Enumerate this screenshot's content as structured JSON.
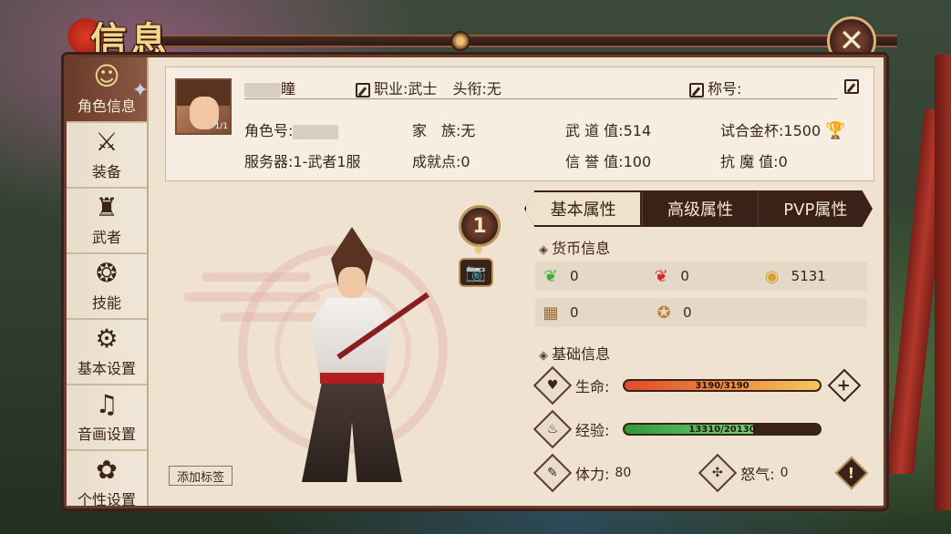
{
  "title": "信息",
  "sidebar": {
    "items": [
      {
        "label": "角色信息",
        "icon": "character-icon"
      },
      {
        "label": "装备",
        "icon": "equipment-icon"
      },
      {
        "label": "武者",
        "icon": "warrior-icon"
      },
      {
        "label": "技能",
        "icon": "skill-icon"
      },
      {
        "label": "基本设置",
        "icon": "settings-gear-icon"
      },
      {
        "label": "音画设置",
        "icon": "audio-visual-icon"
      },
      {
        "label": "个性设置",
        "icon": "personal-flower-icon"
      }
    ]
  },
  "profile": {
    "name_suffix": "瞳",
    "occupation_label": "职业:",
    "occupation": "武士",
    "rank_title_label": "头衔:",
    "rank_title": "无",
    "honor_label": "称号:",
    "honor": "",
    "role_id_label": "角色号:",
    "family_label": "家　族:",
    "family": "无",
    "wudao_label": "武 道 值:",
    "wudao": "514",
    "trial_cup_label": "试合金杯:",
    "trial_cup": "1500",
    "server_label": "服务器:",
    "server": "1-武者1服",
    "achievement_label": "成就点:",
    "achievement": "0",
    "reputation_label": "信 誉 值:",
    "reputation": "100",
    "anti_demon_label": "抗 魔 值:",
    "anti_demon": "0",
    "avatar_level": "1/1"
  },
  "rank_badge": "1",
  "tag_button": "添加标签",
  "tabs": [
    {
      "label": "基本属性",
      "active": true
    },
    {
      "label": "高级属性",
      "active": false
    },
    {
      "label": "PVP属性",
      "active": false
    }
  ],
  "currency": {
    "title": "货币信息",
    "items": [
      {
        "icon": "green-jade-icon",
        "value": "0"
      },
      {
        "icon": "red-jade-icon",
        "value": "0"
      },
      {
        "icon": "gold-coin-icon",
        "value": "5131"
      },
      {
        "icon": "supply-crate-icon",
        "value": "0"
      },
      {
        "icon": "medal-icon",
        "value": "0"
      }
    ]
  },
  "basic": {
    "title": "基础信息",
    "hp_label": "生命:",
    "hp_text": "3190/3190",
    "hp_fraction": 1.0,
    "exp_label": "经验:",
    "exp_text": "13310/20130",
    "exp_fraction": 0.661,
    "stamina_label": "体力:",
    "stamina": "80",
    "rage_label": "怒气:",
    "rage": "0"
  },
  "colors": {
    "panel": "#efe2d0",
    "frame": "#3b2218",
    "accent_gold": "#d9b27a"
  }
}
